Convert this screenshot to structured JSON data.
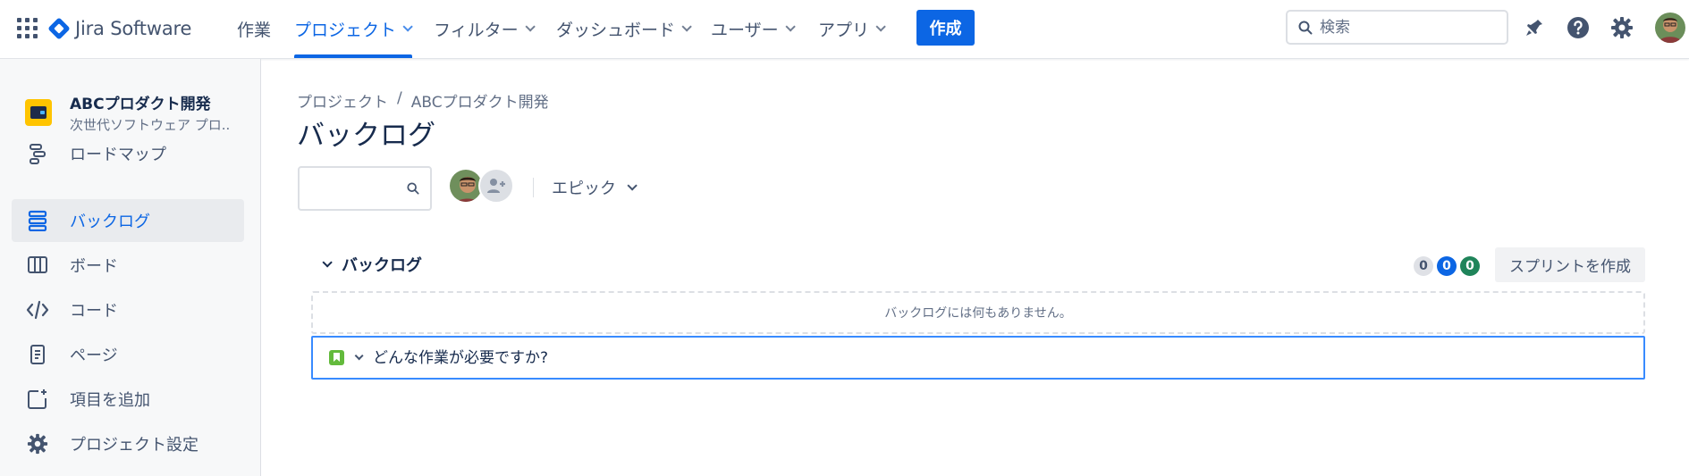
{
  "app": {
    "logo_text": "Jira Software"
  },
  "topnav": {
    "items": [
      {
        "label": "作業"
      },
      {
        "label": "プロジェクト"
      },
      {
        "label": "フィルター"
      },
      {
        "label": "ダッシュボード"
      },
      {
        "label": "ユーザー"
      },
      {
        "label": "アプリ"
      }
    ],
    "active_item": "プロジェクト",
    "create_label": "作成",
    "search_placeholder": "検索",
    "icons": [
      "app-switcher-icon",
      "notification-bell-icon",
      "help-icon",
      "settings-gear-icon",
      "profile-avatar"
    ]
  },
  "sidebar": {
    "project_name": "ABCプロダクト開発",
    "project_type": "次世代ソフトウェア プロ...",
    "items": [
      {
        "label": "ロードマップ",
        "icon": "roadmap-icon"
      },
      {
        "label": "バックログ",
        "icon": "backlog-icon",
        "active": true
      },
      {
        "label": "ボード",
        "icon": "board-icon"
      },
      {
        "label": "コード",
        "icon": "code-icon"
      },
      {
        "label": "ページ",
        "icon": "page-icon"
      },
      {
        "label": "項目を追加",
        "icon": "add-item-icon"
      },
      {
        "label": "プロジェクト設定",
        "icon": "settings-gear-icon"
      }
    ]
  },
  "main": {
    "breadcrumb": [
      "プロジェクト",
      "/",
      "ABCプロダクト開発"
    ],
    "title": "バックログ",
    "filter_search_placeholder": "",
    "epic_filter_label": "エピック",
    "backlog": {
      "section_title": "バックログ",
      "counts": {
        "todo": "0",
        "in_progress": "0",
        "done": "0"
      },
      "create_sprint_label": "スプリントを作成",
      "empty_message": "バックログには何もありません。",
      "create_issue_placeholder": "どんな作業が必要ですか?"
    }
  },
  "colors": {
    "accent": "#0c66e4",
    "count_todo": "#dfe1e6",
    "count_in_progress": "#0c66e4",
    "count_done": "#1f845a",
    "story_green": "#63ba3c"
  }
}
